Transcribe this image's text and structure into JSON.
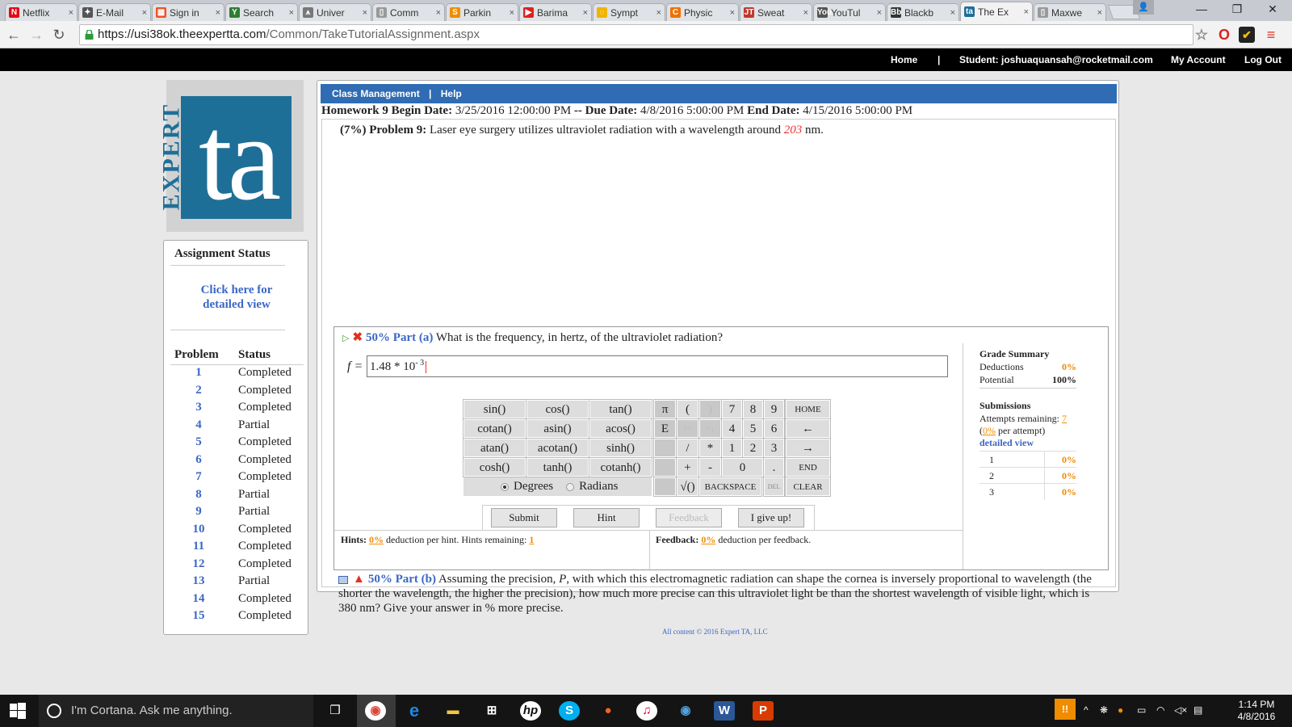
{
  "browser": {
    "tabs": [
      {
        "label": "Netflix",
        "fav": "N",
        "color": "#e50914"
      },
      {
        "label": "E-Mail",
        "fav": "✦",
        "color": "#555"
      },
      {
        "label": "Sign in",
        "fav": "▦",
        "color": "#f25022"
      },
      {
        "label": "Search",
        "fav": "Y",
        "color": "#2e7d32"
      },
      {
        "label": "Univer",
        "fav": "⩚",
        "color": "#777"
      },
      {
        "label": "Comm",
        "fav": "▯",
        "color": "#999"
      },
      {
        "label": "Parkin",
        "fav": "S",
        "color": "#f08c00"
      },
      {
        "label": "Barima",
        "fav": "▶",
        "color": "#e02020"
      },
      {
        "label": "Sympt",
        "fav": "◌",
        "color": "#f0b400"
      },
      {
        "label": "Physic",
        "fav": "C",
        "color": "#f07000"
      },
      {
        "label": "Sweat",
        "fav": "JT",
        "color": "#c0392b"
      },
      {
        "label": "YouTul",
        "fav": "You",
        "color": "#555"
      },
      {
        "label": "Blackb",
        "fav": "Bb",
        "color": "#333"
      },
      {
        "label": "The Ex",
        "fav": "ta",
        "color": "#1e6f98"
      },
      {
        "label": "Maxwe",
        "fav": "▯",
        "color": "#999"
      }
    ],
    "url_host": "https://usi38ok.theexpertta.com",
    "url_path": "/Common/TakeTutorialAssignment.aspx"
  },
  "header": {
    "home": "Home",
    "separator": "|",
    "student": "Student: joshuaquansah@rocketmail.com",
    "my_account": "My Account",
    "log_out": "Log Out"
  },
  "logo": {
    "word": "EXPERT",
    "letters": "ta"
  },
  "status_panel": {
    "title": "Assignment Status",
    "detailed_link": "Click here for detailed view",
    "col_problem": "Problem",
    "col_status": "Status",
    "problems": [
      {
        "num": "1",
        "status": "Completed"
      },
      {
        "num": "2",
        "status": "Completed"
      },
      {
        "num": "3",
        "status": "Completed"
      },
      {
        "num": "4",
        "status": "Partial"
      },
      {
        "num": "5",
        "status": "Completed"
      },
      {
        "num": "6",
        "status": "Completed"
      },
      {
        "num": "7",
        "status": "Completed"
      },
      {
        "num": "8",
        "status": "Partial"
      },
      {
        "num": "9",
        "status": "Partial"
      },
      {
        "num": "10",
        "status": "Completed"
      },
      {
        "num": "11",
        "status": "Completed"
      },
      {
        "num": "12",
        "status": "Completed"
      },
      {
        "num": "13",
        "status": "Partial"
      },
      {
        "num": "14",
        "status": "Completed"
      },
      {
        "num": "15",
        "status": "Completed"
      }
    ]
  },
  "menu": {
    "class_management": "Class Management",
    "sep": "|",
    "help": "Help"
  },
  "homework": {
    "title": "Homework 9",
    "begin_label": "Begin Date:",
    "begin_value": "3/25/2016 12:00:00 PM",
    "dash": "--",
    "due_label": "Due Date:",
    "due_value": "4/8/2016 5:00:00 PM",
    "end_label": "End Date:",
    "end_value": "4/15/2016 5:00:00 PM"
  },
  "problem": {
    "label": "(7%) Problem 9:",
    "text": "Laser eye surgery utilizes ultraviolet radiation with a wavelength around",
    "value": "203",
    "unit": "nm."
  },
  "part_a": {
    "tag": "50% Part (a)",
    "question": "What is the frequency, in hertz, of the ultraviolet radiation?",
    "var": "f =",
    "answer_base": "1.48 * 10",
    "answer_exp": "- 3",
    "keys": [
      "sin()",
      "cos()",
      "tan()",
      "cotan()",
      "asin()",
      "acos()",
      "atan()",
      "acotan()",
      "sinh()",
      "cosh()",
      "tanh()",
      "cotanh()"
    ],
    "pad": [
      "π",
      "(",
      ")",
      "7",
      "8",
      "9",
      "HOME",
      "E",
      "↑^",
      "^↓",
      "4",
      "5",
      "6",
      "←",
      "/",
      "*",
      "1",
      "2",
      "3",
      "→",
      "+",
      "-",
      "0",
      ".",
      "END",
      "√()",
      "BACKSPACE",
      "DEL",
      "CLEAR"
    ],
    "degrees": "Degrees",
    "radians": "Radians",
    "submit": "Submit",
    "hint": "Hint",
    "feedback": "Feedback",
    "give_up": "I give up!",
    "hints_label": "Hints:",
    "hints_pct": "0%",
    "hints_text": "deduction per hint. Hints remaining:",
    "hints_remaining": "1",
    "feedback_label": "Feedback:",
    "feedback_pct": "0%",
    "feedback_text": "deduction per feedback."
  },
  "grade_summary": {
    "title": "Grade Summary",
    "deductions_label": "Deductions",
    "deductions_value": "0%",
    "potential_label": "Potential",
    "potential_value": "100%",
    "submissions_title": "Submissions",
    "attempts_label": "Attempts remaining:",
    "attempts_value": "7",
    "per_attempt_pct": "0%",
    "per_attempt_text": "per attempt)",
    "detailed_view": "detailed view",
    "rows": [
      {
        "n": "1",
        "v": "0%"
      },
      {
        "n": "2",
        "v": "0%"
      },
      {
        "n": "3",
        "v": "0%"
      }
    ]
  },
  "part_b": {
    "tag": "50% Part (b)",
    "text_before_p": "Assuming the precision,",
    "p": "P",
    "text_after_p": ", with which this electromagnetic radiation can shape the cornea is inversely proportional to wavelength (the shorter the wavelength, the higher the precision), how much more precise can this ultraviolet light be than the shortest wavelength of visible light, which is 380 nm? Give your answer in % more precise."
  },
  "footer": "All content © 2016 Expert TA, LLC",
  "taskbar": {
    "cortana": "I'm Cortana. Ask me anything.",
    "time": "1:14 PM",
    "date": "4/8/2016"
  }
}
